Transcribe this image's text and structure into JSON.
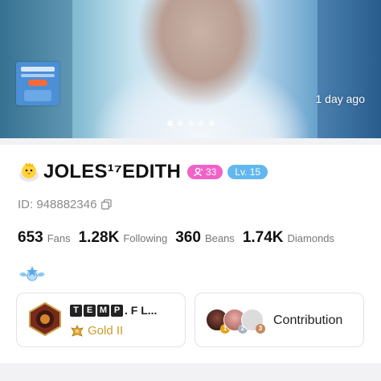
{
  "hero": {
    "time_ago": "1 day ago",
    "carousel_dots": 5,
    "active_dot": 0
  },
  "profile": {
    "username": "JOLES¹⁷EDITH",
    "fans_badge": "33",
    "level_badge": "Lv. 15",
    "id_text": "ID: 948882346"
  },
  "stats": [
    {
      "value": "653",
      "label": "Fans"
    },
    {
      "value": "1.28K",
      "label": "Following"
    },
    {
      "value": "360",
      "label": "Beans"
    },
    {
      "value": "1.74K",
      "label": "Diamonds"
    }
  ],
  "family": {
    "name_boxes": [
      "T",
      "E",
      "M",
      "P"
    ],
    "name_rest": ". F L...",
    "rank": "Gold II"
  },
  "contribution": {
    "label": "Contribution",
    "ranks": [
      "1",
      "2",
      "3"
    ]
  },
  "colors": {
    "fans_badge": "#f062c8",
    "level_badge": "#63b7ee",
    "gold": "#d19a26"
  }
}
